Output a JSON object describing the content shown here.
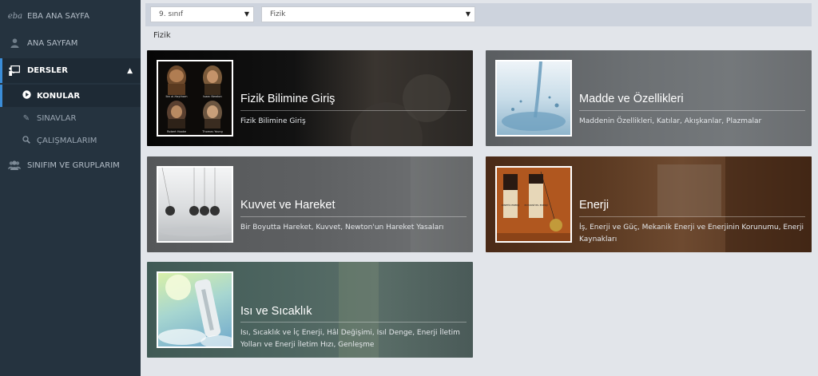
{
  "sidebar": {
    "home_logo": "eba",
    "home": "EBA ANA SAYFA",
    "my_page": "ANA SAYFAM",
    "lessons": "DERSLER",
    "topics": "KONULAR",
    "exams": "SINAVLAR",
    "studies": "ÇALIŞMALARIM",
    "classes": "SINIFIM VE GRUPLARIM"
  },
  "filters": {
    "grade": "9. sınıf",
    "subject": "Fizik"
  },
  "breadcrumb": "Fizik",
  "cards": [
    {
      "title": "Fizik Bilimine Giriş",
      "desc": "Fizik Bilimine Giriş"
    },
    {
      "title": "Madde ve Özellikleri",
      "desc": "Maddenin Özellikleri, Katılar, Akışkanlar, Plazmalar"
    },
    {
      "title": "Kuvvet ve Hareket",
      "desc": "Bir Boyutta Hareket, Kuvvet, Newton'un Hareket Yasaları"
    },
    {
      "title": "Enerji",
      "desc": "İş, Enerji ve Güç, Mekanik Enerji ve Enerjinin Korunumu, Enerji Kaynakları"
    },
    {
      "title": "Isı ve Sıcaklık",
      "desc": "Isı, Sıcaklık ve İç Enerji, Hâl Değişimi, Isıl Denge, Enerji İletim Yolları ve Enerji İletim Hızı, Genleşme"
    }
  ],
  "thumb_text": {
    "scientist_1": "Ibn al-Haytham",
    "scientist_2": "Isaac Newton",
    "scientist_3": "Robert Hooke",
    "scientist_4": "Thomas Young",
    "energy_label_1": "KİNETİK ENERJİ",
    "energy_label_2": "POTANSİYEL ENERJİ"
  },
  "colors": {
    "sidebar": "#25333f",
    "accent": "#3b8dd8",
    "page_bg": "#e2e5ea"
  }
}
